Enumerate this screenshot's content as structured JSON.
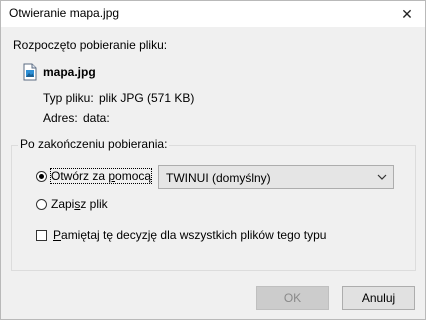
{
  "window": {
    "title": "Otwieranie mapa.jpg",
    "close_glyph": "✕"
  },
  "heading": "Rozpoczęto pobieranie pliku:",
  "file": {
    "name": "mapa.jpg",
    "icon": "image-file-icon",
    "type_label": "Typ pliku:",
    "type_value": "plik JPG (571 KB)",
    "address_label": "Adres:",
    "address_value": "data:"
  },
  "after_download": {
    "legend": "Po zakończeniu pobierania:",
    "open_with": {
      "label_pre": "Otwórz za ",
      "label_underlined": "p",
      "label_post": "omocą",
      "selected": true
    },
    "app_select": {
      "value": "TWINUI (domyślny)"
    },
    "save_file": {
      "label_pre": "Zapi",
      "label_underlined": "s",
      "label_post": "z plik",
      "selected": false
    },
    "remember": {
      "label_pre": "",
      "label_underlined": "P",
      "label_post": "amiętaj tę decyzję dla wszystkich plików tego typu",
      "checked": false
    }
  },
  "buttons": {
    "ok": "OK",
    "cancel": "Anuluj"
  },
  "colors": {
    "window_bg": "#f0f0f0",
    "titlebar_bg": "#ffffff",
    "disabled_button_bg": "#cccccc"
  }
}
